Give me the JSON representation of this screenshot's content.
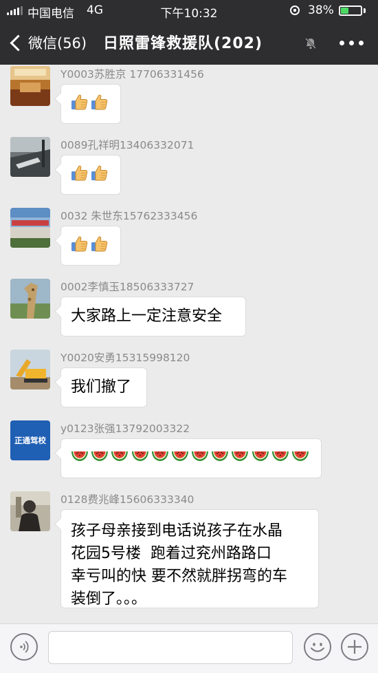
{
  "status_bar": {
    "carrier": "中国电信",
    "network": "4G",
    "time": "下午10:32",
    "battery": "38%",
    "battery_level": 0.38
  },
  "nav": {
    "back_label": "微信(56)",
    "title": "日照雷锋救援队(202)"
  },
  "messages": [
    {
      "sender": "Y0003苏胜京 17706331456",
      "type": "emoji",
      "emoji": "thumbs-up",
      "count": 2
    },
    {
      "sender": "0089孔祥明13406332071",
      "type": "emoji",
      "emoji": "thumbs-up",
      "count": 2
    },
    {
      "sender": "0032 朱世东15762333456",
      "type": "emoji",
      "emoji": "thumbs-up",
      "count": 2
    },
    {
      "sender": "0002李慎玉18506333727",
      "type": "text",
      "lines": [
        "大家路上一定注意安全"
      ]
    },
    {
      "sender": "Y0020安勇15315998120",
      "type": "text",
      "lines": [
        "我们撤了"
      ]
    },
    {
      "sender": "y0123张强13792003322",
      "type": "emoji",
      "emoji": "watermelon",
      "count": 12,
      "avatar_text": "正通驾校"
    },
    {
      "sender": "0128费兆峰15606333340",
      "type": "text",
      "lines": [
        "孩子母亲接到电话说孩子在水晶",
        "花园5号楼  跑着过兖州路路口",
        "幸亏叫的快 要不然就胖拐弯的车",
        "装倒了。。。"
      ]
    }
  ],
  "input_bar": {
    "voice_icon": "voice-icon",
    "emoji_icon": "emoji-icon",
    "add_icon": "plus-icon",
    "value": ""
  }
}
